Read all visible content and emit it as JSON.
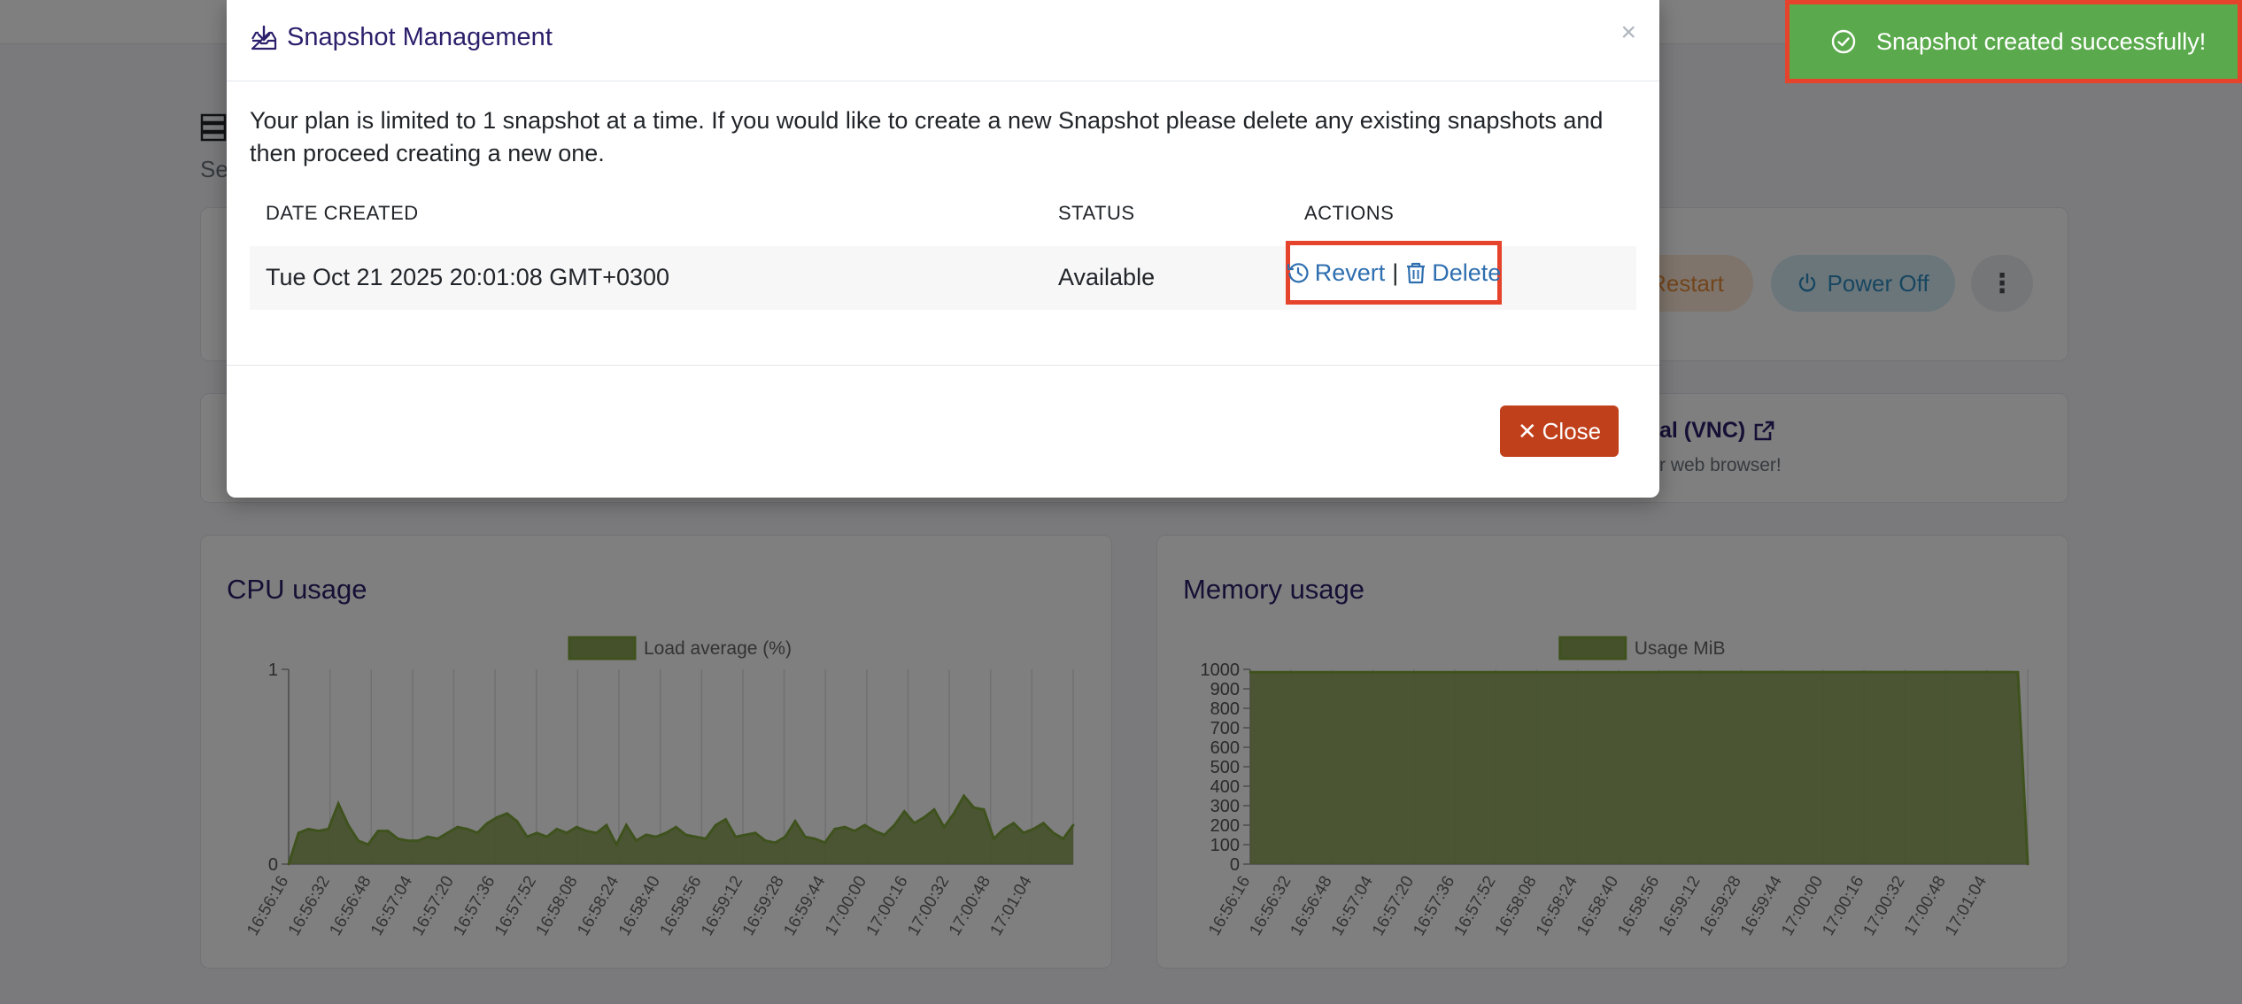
{
  "page": {
    "subtitle_fragment": "Se"
  },
  "server_actions": {
    "restart_label": "Restart",
    "power_off_label": "Power Off",
    "more_icon": "kebab-vertical-icon"
  },
  "vnc_card": {
    "title": "al (VNC)",
    "subtitle": "r web browser!",
    "icon": "external-link-icon"
  },
  "cpu_card": {
    "title": "CPU usage"
  },
  "memory_card": {
    "title": "Memory usage"
  },
  "modal": {
    "title": "Snapshot Management",
    "title_icon": "download-tray-icon",
    "message": "Your plan is limited to 1 snapshot at a time. If you would like to create a new Snapshot please delete any existing snapshots and then proceed creating a new one.",
    "close_x": "×",
    "table": {
      "headers": [
        "DATE CREATED",
        "STATUS",
        "ACTIONS"
      ],
      "rows": [
        {
          "date": "Tue Oct 21 2025 20:01:08 GMT+0300",
          "status": "Available",
          "revert_label": "Revert",
          "separator": "|",
          "delete_label": "Delete"
        }
      ]
    },
    "close_button": "Close"
  },
  "toast": {
    "message": "Snapshot created successfully!",
    "icon": "check-circle-icon"
  },
  "colors": {
    "chart_fill": "#8ba257",
    "chart_stroke": "#7ea43c",
    "brand_purple": "#2c1f6b",
    "close_button": "#c0401c",
    "toast_green": "#5aaa4d",
    "highlight": "#e6432c"
  },
  "chart_data": [
    {
      "type": "area",
      "title": "CPU usage",
      "legend": "Load average (%)",
      "legend_position": "top",
      "ylim": [
        0,
        1
      ],
      "yticks": [
        0,
        1
      ],
      "xticks": [
        "16:56:16",
        "16:56:32",
        "16:56:48",
        "16:57:04",
        "16:57:20",
        "16:57:36",
        "16:57:52",
        "16:58:08",
        "16:58:24",
        "16:58:40",
        "16:58:56",
        "16:59:12",
        "16:59:28",
        "16:59:44",
        "17:00:00",
        "17:00:16",
        "17:00:32",
        "17:00:48",
        "17:01:04"
      ],
      "grid": true,
      "series": [
        {
          "name": "Load average (%)",
          "values": [
            0.0,
            0.16,
            0.18,
            0.17,
            0.18,
            0.31,
            0.2,
            0.12,
            0.1,
            0.17,
            0.17,
            0.13,
            0.12,
            0.12,
            0.14,
            0.13,
            0.16,
            0.19,
            0.18,
            0.16,
            0.21,
            0.24,
            0.26,
            0.22,
            0.14,
            0.16,
            0.14,
            0.18,
            0.16,
            0.19,
            0.17,
            0.16,
            0.2,
            0.1,
            0.2,
            0.12,
            0.15,
            0.14,
            0.16,
            0.19,
            0.15,
            0.14,
            0.13,
            0.2,
            0.23,
            0.14,
            0.15,
            0.16,
            0.12,
            0.11,
            0.14,
            0.22,
            0.14,
            0.13,
            0.11,
            0.18,
            0.19,
            0.17,
            0.2,
            0.17,
            0.15,
            0.2,
            0.27,
            0.21,
            0.24,
            0.28,
            0.19,
            0.26,
            0.35,
            0.29,
            0.28,
            0.13,
            0.18,
            0.21,
            0.16,
            0.18,
            0.21,
            0.16,
            0.13,
            0.2
          ]
        }
      ]
    },
    {
      "type": "area",
      "title": "Memory usage",
      "legend": "Usage MiB",
      "legend_position": "top",
      "ylim": [
        0,
        1000
      ],
      "yticks": [
        0,
        100,
        200,
        300,
        400,
        500,
        600,
        700,
        800,
        900,
        1000
      ],
      "xticks": [
        "16:56:16",
        "16:56:32",
        "16:56:48",
        "16:57:04",
        "16:57:20",
        "16:57:36",
        "16:57:52",
        "16:58:08",
        "16:58:24",
        "16:58:40",
        "16:58:56",
        "16:59:12",
        "16:59:28",
        "16:59:44",
        "17:00:00",
        "17:00:16",
        "17:00:32",
        "17:00:48",
        "17:01:04"
      ],
      "grid": true,
      "series": [
        {
          "name": "Usage MiB",
          "values": [
            985,
            985,
            985,
            985,
            985,
            985,
            985,
            985,
            985,
            985,
            985,
            985,
            985,
            985,
            985,
            985,
            985,
            985,
            985,
            985,
            985,
            985,
            985,
            985,
            985,
            985,
            985,
            985,
            985,
            985,
            985,
            985,
            985,
            985,
            985,
            985,
            985,
            985,
            985,
            985,
            985,
            985,
            986,
            986,
            986,
            986,
            986,
            986,
            986,
            986,
            986,
            986,
            986,
            986,
            986,
            986,
            986,
            986,
            986,
            986,
            986,
            986,
            986,
            986,
            986,
            986,
            986,
            986,
            986,
            986,
            986,
            986,
            986,
            986,
            986,
            986,
            986,
            986,
            985,
            0
          ]
        }
      ]
    }
  ]
}
